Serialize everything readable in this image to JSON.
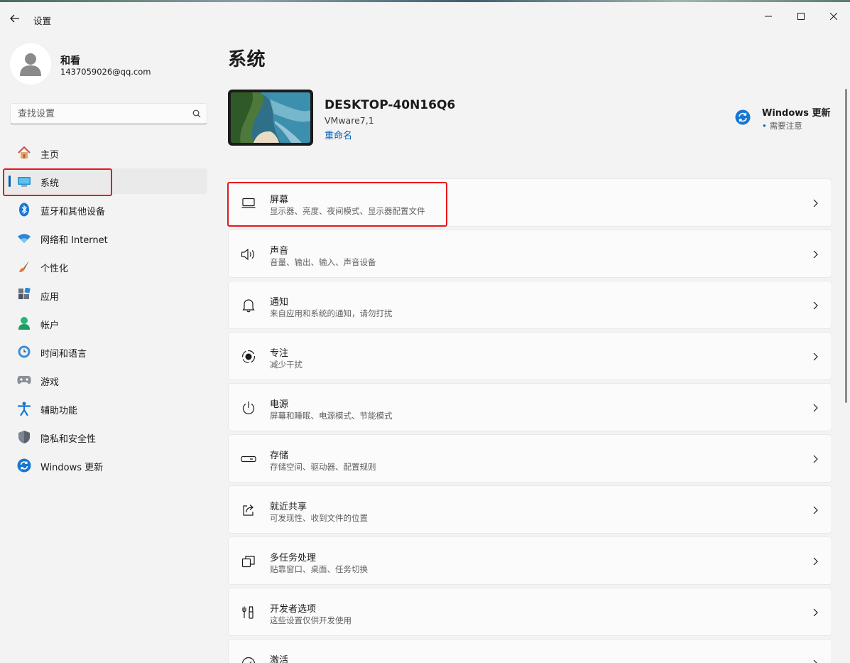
{
  "app": {
    "title": "设置"
  },
  "user": {
    "name": "和看",
    "email": "1437059026@qq.com"
  },
  "search": {
    "placeholder": "查找设置"
  },
  "sidebar": {
    "items": [
      {
        "label": "主页",
        "icon": "home-icon"
      },
      {
        "label": "系统",
        "icon": "system-icon",
        "selected": true
      },
      {
        "label": "蓝牙和其他设备",
        "icon": "bluetooth-icon"
      },
      {
        "label": "网络和 Internet",
        "icon": "wifi-icon"
      },
      {
        "label": "个性化",
        "icon": "brush-icon"
      },
      {
        "label": "应用",
        "icon": "apps-icon"
      },
      {
        "label": "帐户",
        "icon": "account-icon"
      },
      {
        "label": "时间和语言",
        "icon": "clock-globe-icon"
      },
      {
        "label": "游戏",
        "icon": "gamepad-icon"
      },
      {
        "label": "辅助功能",
        "icon": "accessibility-icon"
      },
      {
        "label": "隐私和安全性",
        "icon": "shield-icon"
      },
      {
        "label": "Windows 更新",
        "icon": "update-icon"
      }
    ]
  },
  "main": {
    "title": "系统",
    "device": {
      "name": "DESKTOP-40N16Q6",
      "model": "VMware7,1",
      "rename_label": "重命名"
    },
    "windows_update": {
      "title": "Windows 更新",
      "status": "需要注意"
    },
    "cards": [
      {
        "title": "屏幕",
        "subtitle": "显示器、亮度、夜间模式、显示器配置文件",
        "icon": "monitor-icon"
      },
      {
        "title": "声音",
        "subtitle": "音量、输出、输入、声音设备",
        "icon": "speaker-icon"
      },
      {
        "title": "通知",
        "subtitle": "来自应用和系统的通知，请勿打扰",
        "icon": "bell-icon"
      },
      {
        "title": "专注",
        "subtitle": "减少干扰",
        "icon": "focus-icon"
      },
      {
        "title": "电源",
        "subtitle": "屏幕和睡眠、电源模式、节能模式",
        "icon": "power-icon"
      },
      {
        "title": "存储",
        "subtitle": "存储空间、驱动器、配置规则",
        "icon": "storage-icon"
      },
      {
        "title": "就近共享",
        "subtitle": "可发现性、收到文件的位置",
        "icon": "share-icon"
      },
      {
        "title": "多任务处理",
        "subtitle": "贴靠窗口、桌面、任务切换",
        "icon": "multitask-icon"
      },
      {
        "title": "开发者选项",
        "subtitle": "这些设置仅供开发使用",
        "icon": "developer-icon"
      },
      {
        "title": "激活",
        "subtitle": "",
        "icon": "activation-icon"
      }
    ]
  },
  "colors": {
    "accent": "#005fb8",
    "highlight": "#e8151b",
    "background": "#f3f3f3",
    "card": "#fbfbfb"
  }
}
